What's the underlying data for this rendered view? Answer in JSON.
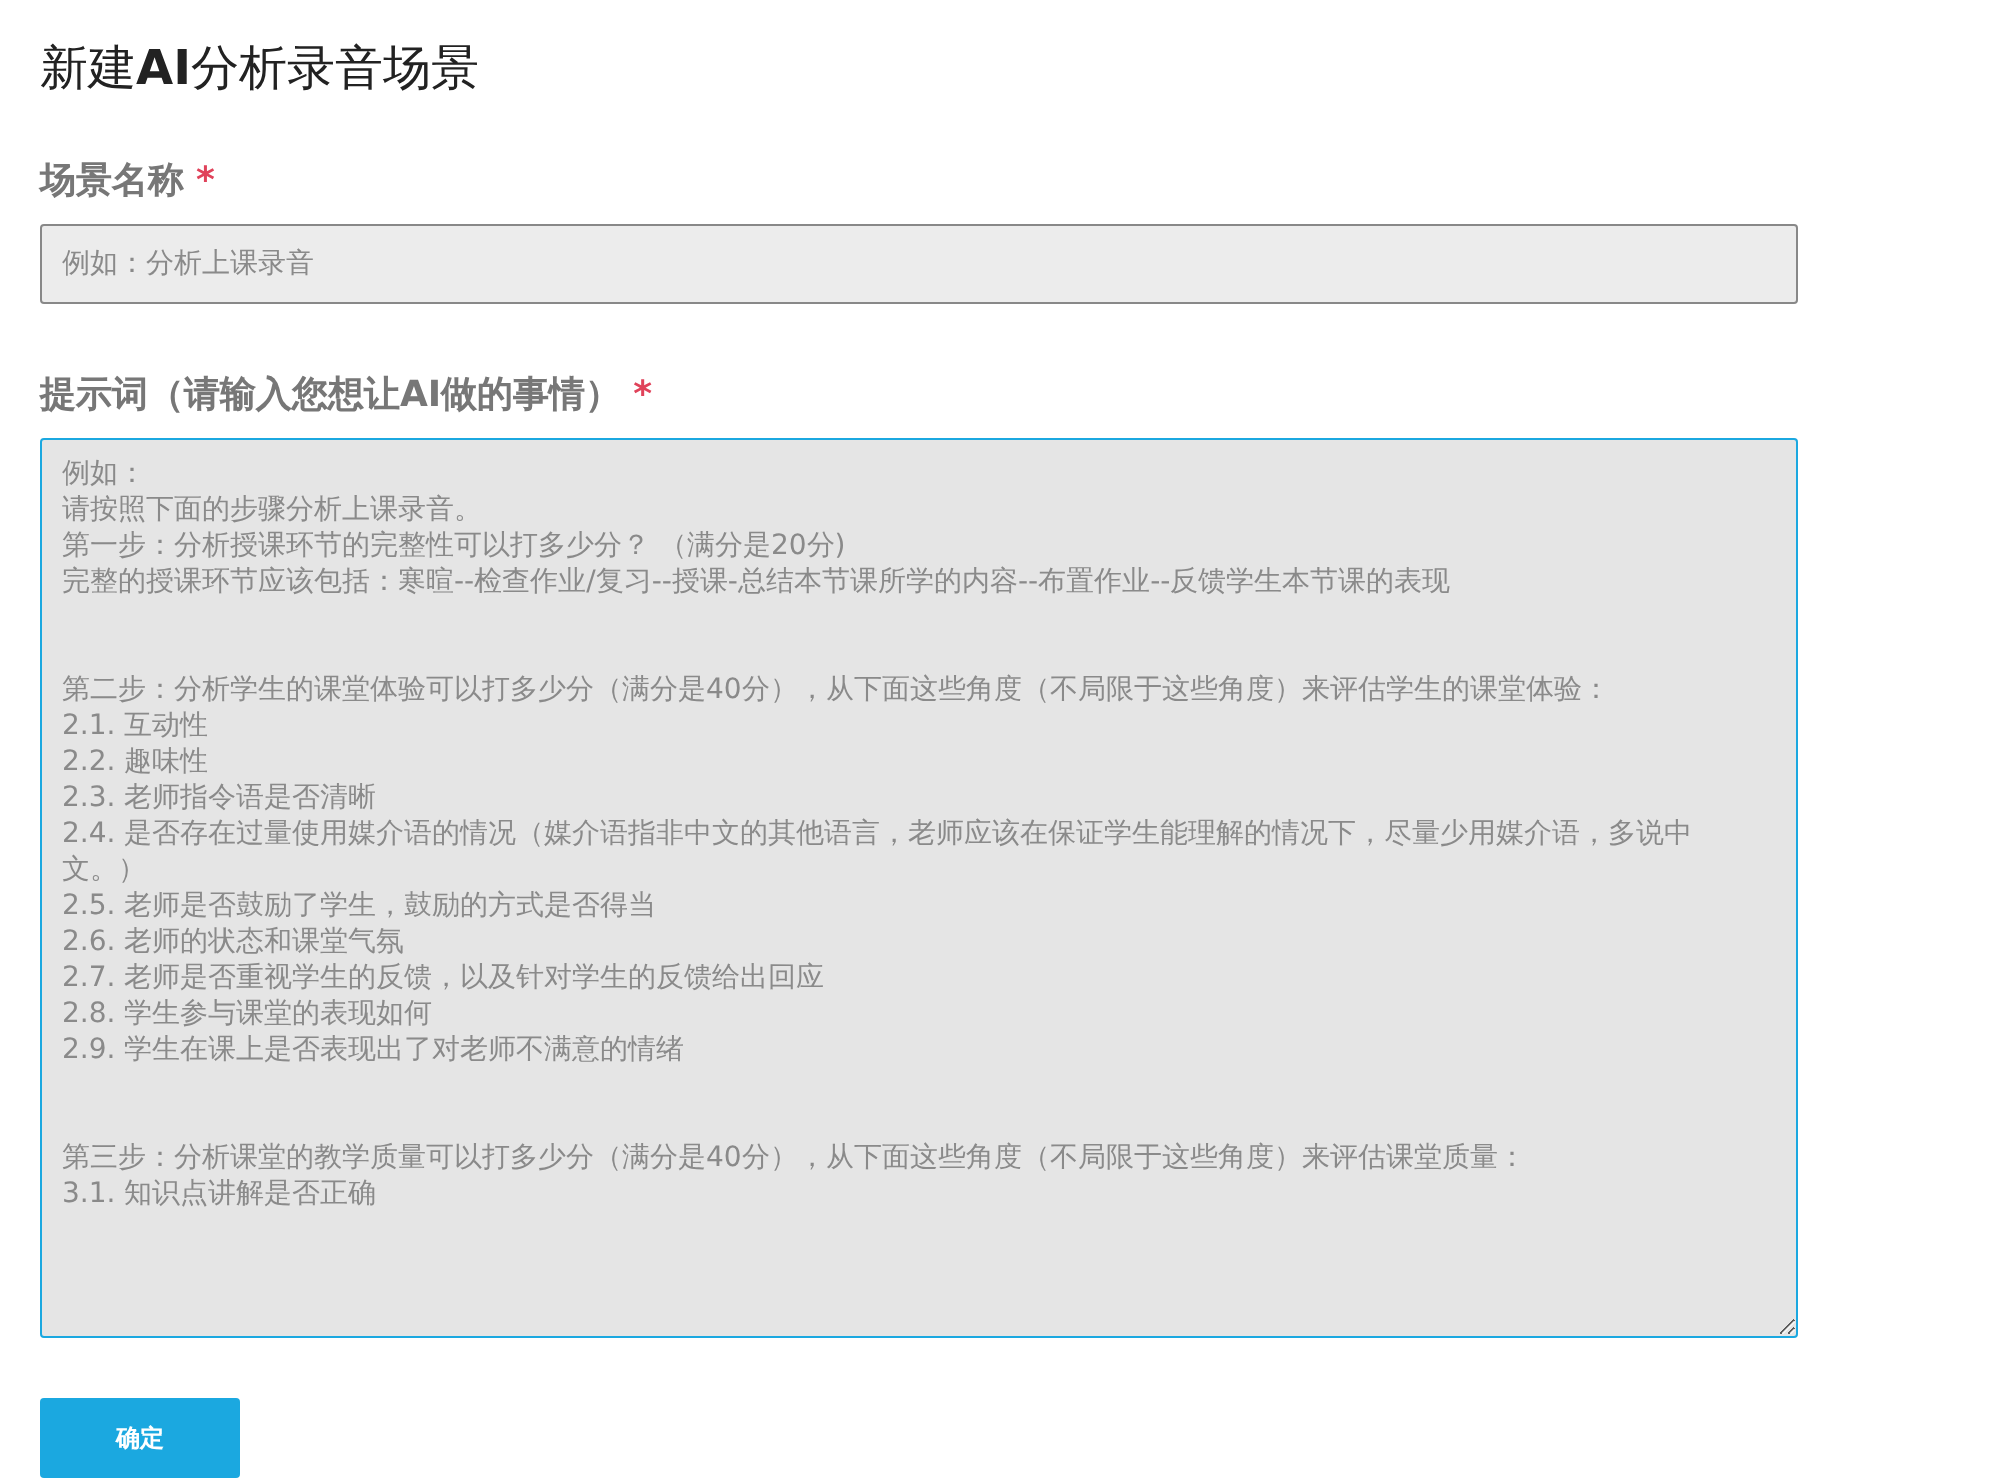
{
  "title": "新建**AI**分析录音场景",
  "fields": [
    {
      "kind": "input",
      "label": "场景名称",
      "required_mark": "*",
      "placeholder_paragraphs": [
        [
          "例如：分析上课录音"
        ]
      ]
    },
    {
      "kind": "textarea",
      "label": "提示词（请输入您想让AI做的事情）",
      "required_mark": "*",
      "placeholder_paragraphs": [
        [
          "例如：",
          "请按照下面的步骤分析上课录音。",
          "第一步：分析授课环节的完整性可以打多少分？ （满分是20分)",
          "完整的授课环节应该包括：寒暄--检查作业/复习--授课-总结本节课所学的内容--布置作业--反馈学生本节课的表现"
        ],
        [
          "第二步：分析学生的课堂体验可以打多少分（满分是40分），从下面这些角度（不局限于这些角度）来评估学生的课堂体验：",
          "2.1. 互动性",
          "2.2. 趣味性",
          "2.3. 老师指令语是否清晰",
          "2.4. 是否存在过量使用媒介语的情况（媒介语指非中文的其他语言，老师应该在保证学生能理解的情况下，尽量少用媒介语，多说中文。）",
          "2.5. 老师是否鼓励了学生，鼓励的方式是否得当",
          "2.6. 老师的状态和课堂气氛",
          "2.7. 老师是否重视学生的反馈，以及针对学生的反馈给出回应",
          "2.8. 学生参与课堂的表现如何",
          "2.9. 学生在课上是否表现出了对老师不满意的情绪"
        ],
        [
          "第三步：分析课堂的教学质量可以打多少分（满分是40分），从下面这些角度（不局限于这些角度）来评估课堂质量：",
          "3.1. 知识点讲解是否正确"
        ]
      ],
      "focused": true
    }
  ],
  "submit": "确定"
}
